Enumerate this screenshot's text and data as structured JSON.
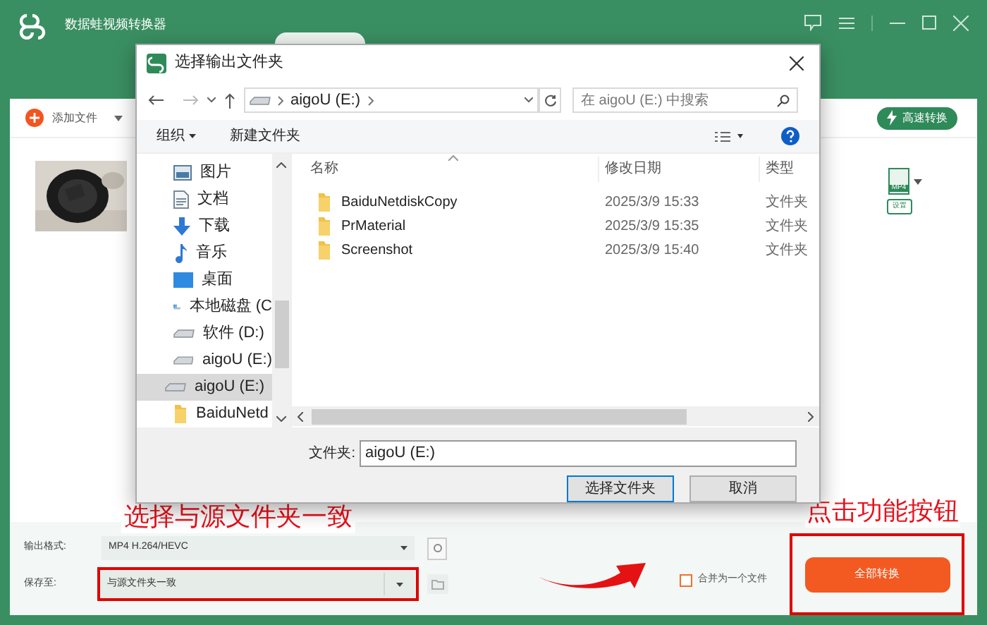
{
  "app": {
    "title": "数据蛙视频转换器",
    "toolbar": {
      "add_button": "添加文件",
      "fast_button": "高速转换"
    },
    "file_format": {
      "badge": "MP4",
      "setting_button": "设置"
    },
    "bottom": {
      "format_label": "输出格式:",
      "format_value": "MP4 H.264/HEVC",
      "save_label": "保存至:",
      "save_value": "与源文件夹一致",
      "merge": {
        "label": "合并为一个文件",
        "checked": false
      },
      "convert_button": "全部转换"
    }
  },
  "dialog": {
    "title": "选择输出文件夹",
    "path": "aigoU (E:)",
    "search": {
      "placeholder": "在 aigoU (E:) 中搜索"
    },
    "toolbar": {
      "organize": "组织",
      "new_folder": "新建文件夹"
    },
    "nav": [
      {
        "label": "图片",
        "kind": "pictures",
        "selected": false
      },
      {
        "label": "文档",
        "kind": "documents",
        "selected": false
      },
      {
        "label": "下载",
        "kind": "downloads",
        "selected": false
      },
      {
        "label": "音乐",
        "kind": "music",
        "selected": false
      },
      {
        "label": "桌面",
        "kind": "desktop",
        "selected": false
      },
      {
        "label": "本地磁盘 (C",
        "kind": "system",
        "selected": false
      },
      {
        "label": "软件 (D:)",
        "kind": "drive",
        "selected": false
      },
      {
        "label": "aigoU (E:)",
        "kind": "drive",
        "selected": false
      },
      {
        "label": "aigoU (E:)",
        "kind": "drive",
        "selected": true,
        "children": [
          {
            "label": "BaiduNetd",
            "kind": "folder",
            "selected": false
          }
        ]
      }
    ],
    "columns": [
      "名称",
      "修改日期",
      "类型"
    ],
    "rows": [
      {
        "name": "BaiduNetdiskCopy",
        "date": "2025/3/9 15:33",
        "type": "文件夹"
      },
      {
        "name": "PrMaterial",
        "date": "2025/3/9 15:35",
        "type": "文件夹"
      },
      {
        "name": "Screenshot",
        "date": "2025/3/9 15:40",
        "type": "文件夹"
      }
    ],
    "folder_label": "文件夹:",
    "folder_value": "aigoU (E:)",
    "buttons": [
      {
        "label": "选择文件夹",
        "kind": "primary"
      },
      {
        "label": "取消",
        "kind": "normal"
      }
    ]
  },
  "annotations": {
    "left": "选择与源文件夹一致",
    "right": "点击功能按钮"
  }
}
